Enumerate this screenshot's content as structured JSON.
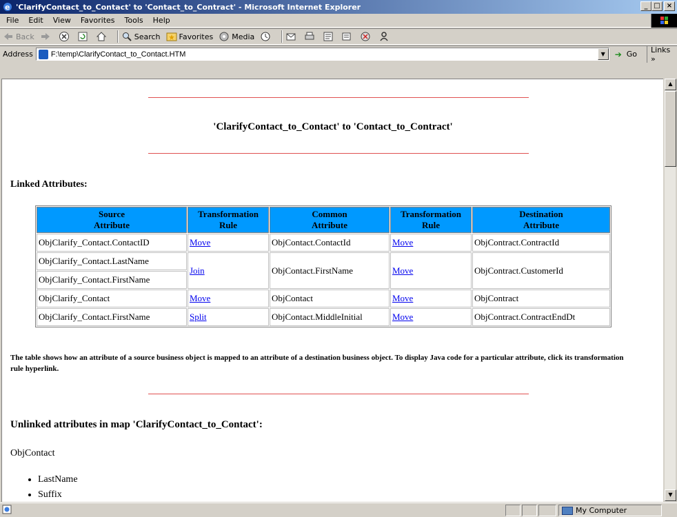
{
  "window": {
    "title": "'ClarifyContact_to_Contact' to 'Contact_to_Contract' - Microsoft Internet Explorer",
    "minimize": "_",
    "maximize": "□",
    "close": "×"
  },
  "menu": {
    "items": [
      "File",
      "Edit",
      "View",
      "Favorites",
      "Tools",
      "Help"
    ]
  },
  "toolbar": {
    "back": "Back",
    "search": "Search",
    "favorites": "Favorites",
    "media": "Media"
  },
  "address": {
    "label": "Address",
    "url": "F:\\temp\\ClarifyContact_to_Contact.HTM",
    "go": "Go",
    "links": "Links »"
  },
  "page": {
    "title": "'ClarifyContact_to_Contact' to 'Contact_to_Contract'",
    "linked_heading": "Linked Attributes:",
    "table": {
      "headers": [
        "Source\nAttribute",
        "Transformation\nRule",
        "Common\nAttribute",
        "Transformation\nRule",
        "Destination\nAttribute"
      ],
      "h1a": "Source",
      "h1b": "Attribute",
      "h2a": "Transformation",
      "h2b": "Rule",
      "h3a": "Common",
      "h3b": "Attribute",
      "h4a": "Transformation",
      "h4b": "Rule",
      "h5a": "Destination",
      "h5b": "Attribute",
      "rows": [
        {
          "source": "ObjClarify_Contact.ContactID",
          "rule1": "Move",
          "common": "ObjContact.ContactId",
          "rule2": "Move",
          "dest": "ObjContract.ContractId"
        },
        {
          "source": "ObjClarify_Contact.LastName",
          "source2": "ObjClarify_Contact.FirstName",
          "rule1": "Join",
          "common": "ObjContact.FirstName",
          "rule2": "Move",
          "dest": "ObjContract.CustomerId"
        },
        {
          "source": "ObjClarify_Contact",
          "rule1": "Move",
          "common": "ObjContact",
          "rule2": "Move",
          "dest": "ObjContract"
        },
        {
          "source": "ObjClarify_Contact.FirstName",
          "rule1": "Split",
          "common": "ObjContact.MiddleInitial",
          "rule2": "Move",
          "dest": "ObjContract.ContractEndDt"
        }
      ]
    },
    "note": "The table shows how an attribute of a source business object is mapped to an attribute of a destination business object. To display Java code for a particular attribute, click its transformation rule hyperlink.",
    "unlinked_heading": "Unlinked attributes in map 'ClarifyContact_to_Contact':",
    "unlinked_object": "ObjContact",
    "unlinked_items": [
      "LastName",
      "Suffix"
    ]
  },
  "status": {
    "zone": "My Computer"
  }
}
